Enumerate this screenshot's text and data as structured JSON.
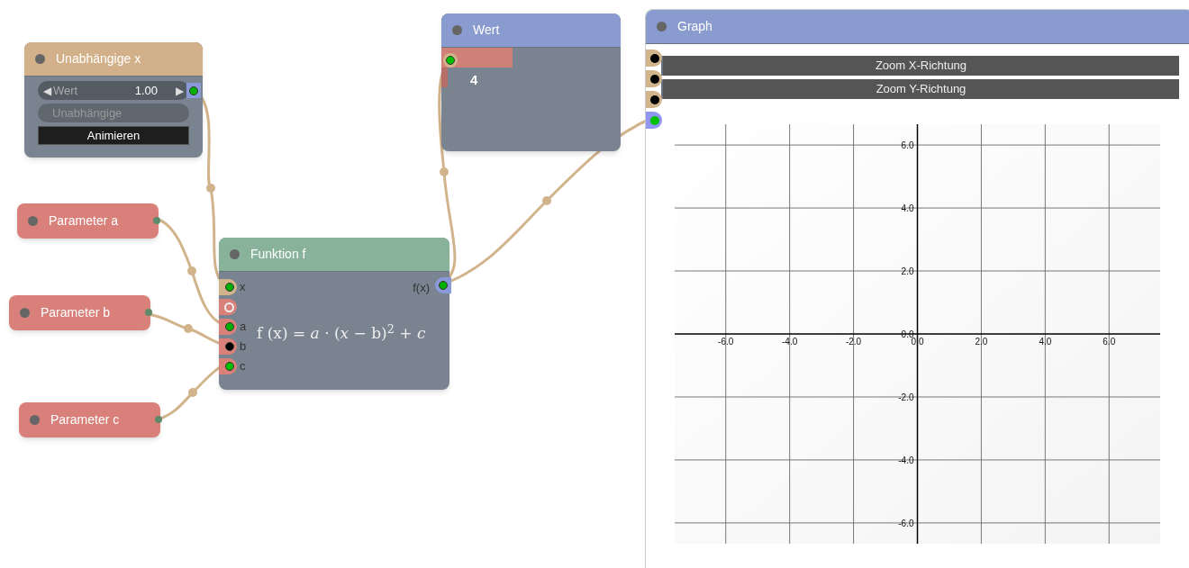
{
  "nodes": {
    "independent": {
      "title": "Unabhängige x",
      "stepper": {
        "left_arrow": "◀",
        "label": "Wert",
        "value": "1.00",
        "right_arrow": "▶"
      },
      "name_field": {
        "placeholder": "Unabhängige"
      },
      "button": "Animieren",
      "output": {
        "color": "#00b000"
      }
    },
    "parameters": [
      {
        "title": "Parameter a"
      },
      {
        "title": "Parameter b"
      },
      {
        "title": "Parameter c"
      }
    ],
    "function": {
      "title": "Funktion f",
      "inputs": [
        {
          "kind": "dot",
          "label": "x",
          "color": "#00b000",
          "tab": {
            "color": "#d2b48c"
          }
        },
        {
          "kind": "ring",
          "tab": {
            "color": "#d9807a"
          }
        },
        {
          "kind": "dot",
          "label": "a",
          "color": "#00b000",
          "tab": {
            "color": "#d9807a"
          }
        },
        {
          "kind": "dot",
          "label": "b",
          "color": "#000000",
          "tab": {
            "color": "#d9807a"
          }
        },
        {
          "kind": "dot",
          "label": "c",
          "color": "#00c000",
          "tab": {
            "color": "#d9807a"
          }
        }
      ],
      "formula": "f (x) = *a* · (*x* − b)$^{2}$ + *c*",
      "output": {
        "label": "f(x)",
        "color": "#00b000"
      }
    },
    "value": {
      "title": "Wert",
      "value": "4",
      "input": {
        "color": "#00c000"
      }
    },
    "graph": {
      "title": "Graph",
      "buttons": [
        "Zoom X-Richtung",
        "Zoom Y-Richtung"
      ],
      "ports": [
        {
          "color": "#000000",
          "tab": {
            "color": "#d2b48c"
          }
        },
        {
          "color": "#000000",
          "tab": {
            "color": "#d2b48c"
          }
        },
        {
          "color": "#000000",
          "tab": {
            "color": "#d2b48c"
          }
        },
        {
          "color": "#00c000",
          "tab": {
            "color": "#8f97f0"
          }
        }
      ],
      "chart_data": {
        "type": "line",
        "grid": true,
        "xlim": [
          -7.6,
          7.6
        ],
        "ylim": [
          -6.66,
          6.66
        ],
        "xticks": [
          {
            "value": -6,
            "label": "-6.0"
          },
          {
            "value": -4,
            "label": "-4.0"
          },
          {
            "value": -2,
            "label": "-2.0"
          },
          {
            "value": 0,
            "label": "0.0"
          },
          {
            "value": 2,
            "label": "2.0"
          },
          {
            "value": 4,
            "label": "4.0"
          },
          {
            "value": 6,
            "label": "6.0"
          }
        ],
        "yticks": [
          {
            "value": 6,
            "label": "6.0"
          },
          {
            "value": 4,
            "label": "4.0"
          },
          {
            "value": 2,
            "label": "2.0"
          },
          {
            "value": 0,
            "label": "0.0"
          },
          {
            "value": -2,
            "label": "-2.0"
          },
          {
            "value": -4,
            "label": "-4.0"
          },
          {
            "value": -6,
            "label": "-6.0"
          }
        ]
      }
    }
  }
}
